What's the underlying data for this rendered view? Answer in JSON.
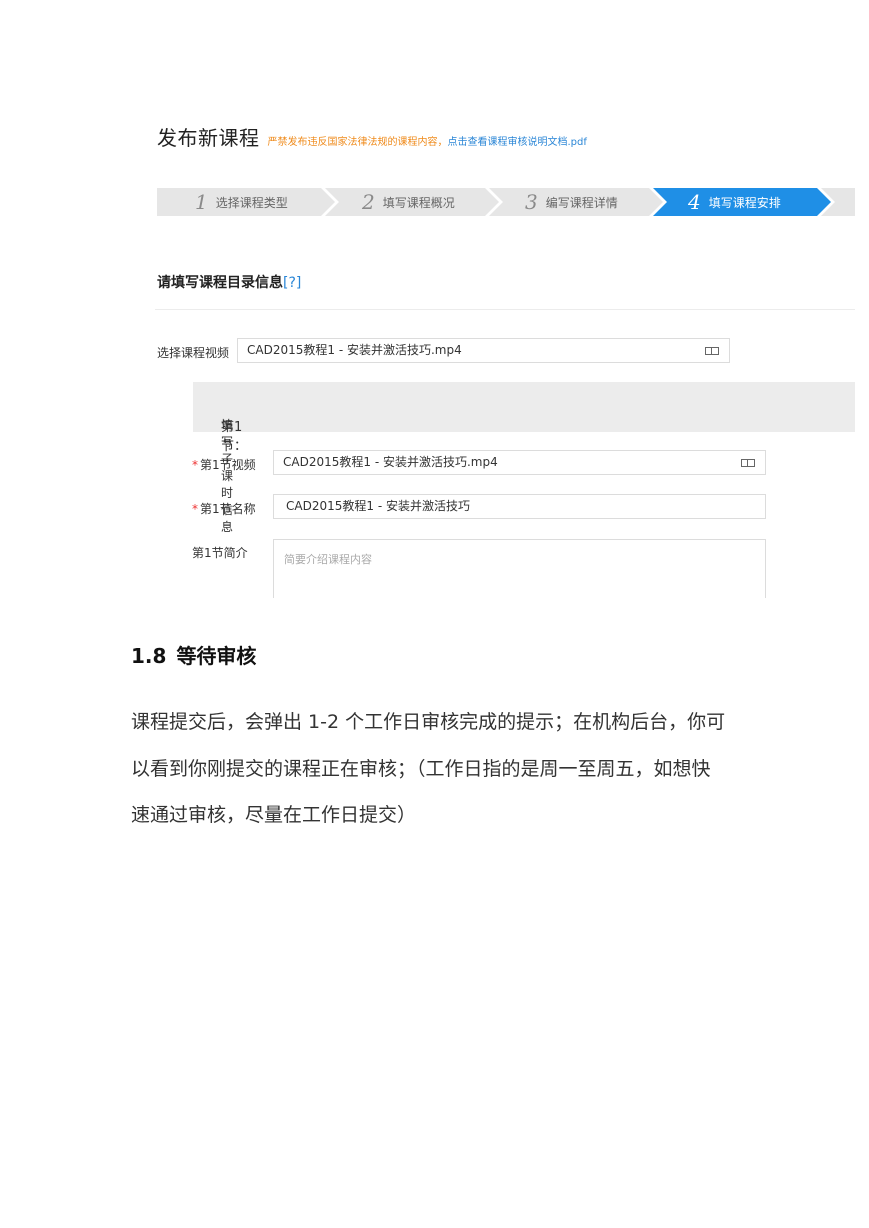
{
  "screenshot": {
    "title": "发布新课程",
    "warning": "严禁发布违反国家法律法规的课程内容，",
    "doc_link": "点击查看课程审核说明文档.pdf",
    "steps": [
      {
        "num": "1",
        "label": "选择课程类型",
        "active": false
      },
      {
        "num": "2",
        "label": "填写课程概况",
        "active": false
      },
      {
        "num": "3",
        "label": "编写课程详情",
        "active": false
      },
      {
        "num": "4",
        "label": "填写课程安排",
        "active": true
      }
    ],
    "section_title": "请填写课程目录信息",
    "section_help": "[?]",
    "select_video_label": "选择课程视频",
    "select_video_value": "CAD2015教程1 - 安装并激活技巧.mp4",
    "lesson_header_index": "第1节：",
    "lesson_header_text": "填写子课时信息",
    "required_mark": "*",
    "lesson_video_label": "第1节视频",
    "lesson_video_value": "CAD2015教程1 - 安装并激活技巧.mp4",
    "lesson_name_label": "第1节名称",
    "lesson_name_value": "CAD2015教程1 - 安装并激活技巧",
    "lesson_intro_label": "第1节简介",
    "lesson_intro_placeholder": "简要介绍课程内容"
  },
  "document": {
    "section_number": "1.8",
    "section_title": "等待审核",
    "lines": [
      "课程提交后，会弹出 1-2 个工作日审核完成的提示；在机构后台，你可",
      "以看到你刚提交的课程正在审核；（工作日指的是周一至周五，如想快",
      "速通过审核，尽量在工作日提交）"
    ]
  },
  "colors": {
    "warning": "#ef8a1a",
    "link": "#2a86d6",
    "step_active": "#1f8fe6",
    "step_inactive": "#e6e6e6",
    "required": "#e33333"
  }
}
